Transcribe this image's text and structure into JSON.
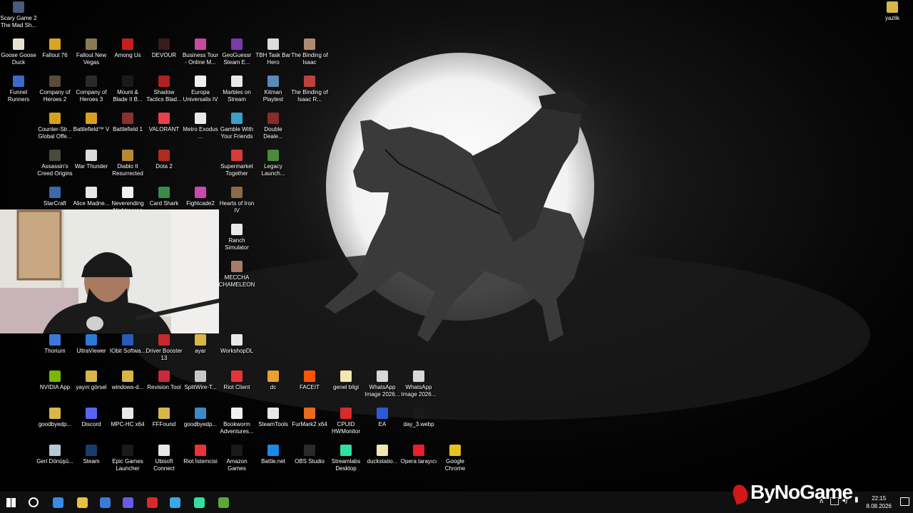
{
  "desktop": {
    "icons": [
      {
        "label": "Scary Game 2 The Mad Sh...",
        "icon": "scary-game-icon",
        "color": "#4a5a7a"
      },
      {
        "label": "yazlik",
        "icon": "folder-icon",
        "color": "#d9b64a"
      },
      {
        "label": "Goose Goose Duck",
        "icon": "goose-icon",
        "color": "#e7e2d0"
      },
      {
        "label": "Fallout 76",
        "icon": "fallout-icon",
        "color": "#d8a520"
      },
      {
        "label": "Fallout New Vegas",
        "icon": "fallout-nv-icon",
        "color": "#8a7a50"
      },
      {
        "label": "Among Us",
        "icon": "among-us-icon",
        "color": "#c81e1e"
      },
      {
        "label": "DEVOUR",
        "icon": "devour-icon",
        "color": "#3a1a1a"
      },
      {
        "label": "Business Tour - Online M...",
        "icon": "business-tour-icon",
        "color": "#c84aa0"
      },
      {
        "label": "GeoGuessr Steam E...",
        "icon": "geoguessr-icon",
        "color": "#7a3aa8"
      },
      {
        "label": "TBH Task Bar Hero",
        "icon": "tbh-icon",
        "color": "#dcdcdc"
      },
      {
        "label": "The Binding of Isaac",
        "icon": "isaac-icon",
        "color": "#b08a70"
      },
      {
        "label": "Funnel Runners",
        "icon": "funnel-icon",
        "color": "#3a6ac8"
      },
      {
        "label": "Company of Heroes 2",
        "icon": "coh2-icon",
        "color": "#5a4a3a"
      },
      {
        "label": "Company of Heroes 3",
        "icon": "coh3-icon",
        "color": "#2a2a2a"
      },
      {
        "label": "Mount & Blade II B...",
        "icon": "bannerlord-icon",
        "color": "#1a1a1a"
      },
      {
        "label": "Shadow Tactics Blad...",
        "icon": "shadow-tactics-icon",
        "color": "#b02020"
      },
      {
        "label": "Europa Universalis IV",
        "icon": "file-icon",
        "color": "#f0f0f0"
      },
      {
        "label": "Marbles on Stream",
        "icon": "marbles-icon",
        "color": "#e8e8e8"
      },
      {
        "label": "Kitman Playtest",
        "icon": "kitman-icon",
        "color": "#5a8ab8"
      },
      {
        "label": "The Binding of Isaac R...",
        "icon": "isaac-rebirth-icon",
        "color": "#c04040"
      },
      {
        "label": "Counter-Str... Global Offe...",
        "icon": "csgo-icon",
        "color": "#d8a020"
      },
      {
        "label": "Battlefield™ V",
        "icon": "bfv-icon",
        "color": "#d8a020"
      },
      {
        "label": "Battlefield 1",
        "icon": "bf1-icon",
        "color": "#8a3030"
      },
      {
        "label": "VALORANT",
        "icon": "valorant-icon",
        "color": "#e8404a"
      },
      {
        "label": "Metro Exodus ...",
        "icon": "metro-icon",
        "color": "#e8e8e8"
      },
      {
        "label": "Gamble With Your Friends",
        "icon": "gamble-icon",
        "color": "#3aa0c8"
      },
      {
        "label": "Double Deale...",
        "icon": "double-dealer-icon",
        "color": "#8a2a2a"
      },
      {
        "label": "Assassin's Creed Origins",
        "icon": "ac-origins-icon",
        "color": "#4a4a3a"
      },
      {
        "label": "War Thunder",
        "icon": "war-thunder-icon",
        "color": "#dcdcdc"
      },
      {
        "label": "Diablo II Resurrected",
        "icon": "diablo-icon",
        "color": "#b88a30"
      },
      {
        "label": "Dota 2",
        "icon": "dota2-icon",
        "color": "#b02a20"
      },
      {
        "label": "Supermarket Together",
        "icon": "supermarket-icon",
        "color": "#d83a3a"
      },
      {
        "label": "Legacy Launch...",
        "icon": "legacy-icon",
        "color": "#4a8a3a"
      },
      {
        "label": "StarCraft",
        "icon": "starcraft-icon",
        "color": "#3a6aa8"
      },
      {
        "label": "Alice Madne...",
        "icon": "alice-icon",
        "color": "#e8e8e8"
      },
      {
        "label": "Neverending Nightmares",
        "icon": "file-icon",
        "color": "#f0f0f0"
      },
      {
        "label": "Card Shark",
        "icon": "card-shark-icon",
        "color": "#3a8a4a"
      },
      {
        "label": "Fightcade2",
        "icon": "fightcade-icon",
        "color": "#c84ab0"
      },
      {
        "label": "Hearts of Iron IV",
        "icon": "hoi4-icon",
        "color": "#8a6a4a"
      },
      {
        "label": "Ranch Simulator",
        "icon": "ranch-icon",
        "color": "#e8e8e8"
      },
      {
        "label": "MECCHA CHAMELEON",
        "icon": "meccha-icon",
        "color": "#a87a6a"
      },
      {
        "label": "Thorium",
        "icon": "thorium-icon",
        "color": "#3a7ad8"
      },
      {
        "label": "UltraViewer",
        "icon": "ultraviewer-icon",
        "color": "#2a7ad8"
      },
      {
        "label": "IObit Softwa...",
        "icon": "iobit-icon",
        "color": "#2a5ab8"
      },
      {
        "label": "Driver Booster 13",
        "icon": "driver-booster-icon",
        "color": "#c82a2a"
      },
      {
        "label": "ayar",
        "icon": "folder-icon",
        "color": "#d9b64a"
      },
      {
        "label": "WorkshopDL",
        "icon": "workshopdl-icon",
        "color": "#e8e8e8"
      },
      {
        "label": "NVIDIA App",
        "icon": "nvidia-icon",
        "color": "#76b900"
      },
      {
        "label": "yayın görsel",
        "icon": "folder-icon",
        "color": "#d9b64a"
      },
      {
        "label": "windows-d...",
        "icon": "folder-icon",
        "color": "#d9b64a"
      },
      {
        "label": "Revision Tool",
        "icon": "revision-icon",
        "color": "#c82a3a"
      },
      {
        "label": "SplitWire-T...",
        "icon": "splitwire-icon",
        "color": "#c8c8c8"
      },
      {
        "label": "Riot Client",
        "icon": "riot-client-icon",
        "color": "#e8333a"
      },
      {
        "label": "dc",
        "icon": "dc-icon",
        "color": "#e8a030"
      },
      {
        "label": "FACEIT",
        "icon": "faceit-icon",
        "color": "#ff5500"
      },
      {
        "label": "genel bilgi",
        "icon": "file-icon",
        "color": "#f0e8b0"
      },
      {
        "label": "WhatsApp Image 2026...",
        "icon": "image-file-icon",
        "color": "#d8d8d8"
      },
      {
        "label": "WhatsApp Image 2026...",
        "icon": "image-file-icon",
        "color": "#d8d8d8"
      },
      {
        "label": "goodbyedp...",
        "icon": "folder-icon",
        "color": "#d9b64a"
      },
      {
        "label": "Discord",
        "icon": "discord-icon",
        "color": "#5865f2"
      },
      {
        "label": "MPC-HC x64",
        "icon": "mpc-icon",
        "color": "#e8e8e8"
      },
      {
        "label": "FFFound",
        "icon": "folder-icon",
        "color": "#d9b64a"
      },
      {
        "label": "goodbyedp...",
        "icon": "goodbyedpi-icon",
        "color": "#3a8ac8"
      },
      {
        "label": "Bookworm Adventures...",
        "icon": "file-icon",
        "color": "#f0f0f0"
      },
      {
        "label": "SteamTools",
        "icon": "steamtools-icon",
        "color": "#e8e8e8"
      },
      {
        "label": "FurMark2 x64",
        "icon": "furmark-icon",
        "color": "#e86a1a"
      },
      {
        "label": "CPUID HWMonitor",
        "icon": "hwmonitor-icon",
        "color": "#d82a2a"
      },
      {
        "label": "EA",
        "icon": "ea-icon",
        "color": "#2a5ad8"
      },
      {
        "label": "day_3.webp",
        "icon": "image-file-icon",
        "color": "#1a1a1a"
      },
      {
        "label": "Geri Dönüşü...",
        "icon": "recycle-bin-icon",
        "color": "#b8c8d8"
      },
      {
        "label": "Steam",
        "icon": "steam-icon",
        "color": "#1a3a6a"
      },
      {
        "label": "Epic Games Launcher",
        "icon": "epic-icon",
        "color": "#1a1a1a"
      },
      {
        "label": "Ubisoft Connect",
        "icon": "ubisoft-icon",
        "color": "#e8e8e8"
      },
      {
        "label": "Riot İstemcisi",
        "icon": "riot-icon",
        "color": "#e8333a"
      },
      {
        "label": "Amazon Games",
        "icon": "amazon-games-icon",
        "color": "#1a1a1a"
      },
      {
        "label": "Battle.net",
        "icon": "battlenet-icon",
        "color": "#1a8ae8"
      },
      {
        "label": "OBS Studio",
        "icon": "obs-icon",
        "color": "#2a2a2a"
      },
      {
        "label": "Streamlabs Desktop",
        "icon": "streamlabs-icon",
        "color": "#30e0a0"
      },
      {
        "label": "duckstatio...",
        "icon": "file-icon",
        "color": "#f0e8b0"
      },
      {
        "label": "Opera tarayıcı",
        "icon": "opera-icon",
        "color": "#e8202a"
      },
      {
        "label": "Google Chrome",
        "icon": "chrome-icon",
        "color": "#e8c020"
      }
    ]
  },
  "taskbar": {
    "items": [
      {
        "icon": "start-windows-icon",
        "color": "#ffffff"
      },
      {
        "icon": "search-icon",
        "color": "#ffffff"
      },
      {
        "icon": "calendar-app-icon",
        "color": "#3a8ae8"
      },
      {
        "icon": "file-explorer-icon",
        "color": "#e8c040"
      },
      {
        "icon": "thorium-icon",
        "color": "#3a7ad8"
      },
      {
        "icon": "app-icon",
        "color": "#6a5ae8"
      },
      {
        "icon": "record-icon",
        "color": "#d82a2a"
      },
      {
        "icon": "network-app-icon",
        "color": "#3aa8e8"
      },
      {
        "icon": "streamlabs-icon",
        "color": "#30e0a0"
      },
      {
        "icon": "minecraft-icon",
        "color": "#5aa83a"
      }
    ],
    "time": "22:15",
    "date": "8.08.2026"
  },
  "brand": {
    "text": "ByNoGame"
  }
}
